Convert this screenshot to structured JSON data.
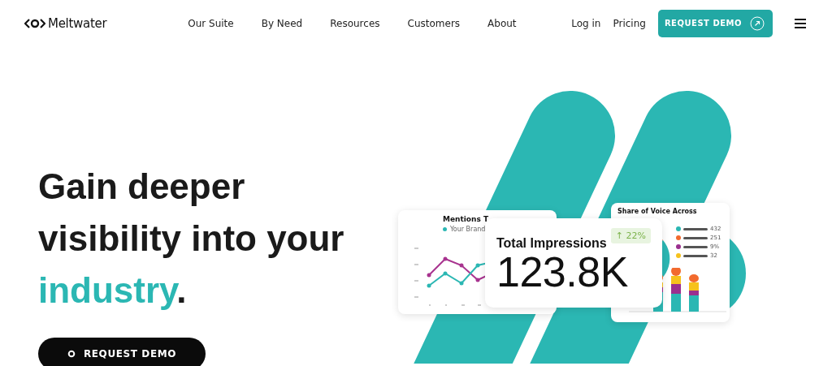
{
  "header": {
    "logo": "Meltwater",
    "nav": [
      "Our Suite",
      "By Need",
      "Resources",
      "Customers",
      "About"
    ],
    "login": "Log in",
    "pricing": "Pricing",
    "cta": "REQUEST DEMO"
  },
  "hero": {
    "headline": [
      [
        {
          "text": "Gain deeper",
          "accent": false
        }
      ],
      [
        {
          "text": "visibility into your",
          "accent": false
        }
      ],
      [
        {
          "text": "industry",
          "accent": true
        },
        {
          "text": ".",
          "accent": false
        }
      ]
    ],
    "cta": "REQUEST DEMO"
  },
  "illustration": {
    "mentions_card": {
      "title": "Mentions T",
      "legend": "Your Brand"
    },
    "impressions_card": {
      "title": "Total Impressions",
      "value": "123.8K",
      "change": "↑ 22%"
    },
    "share_card": {
      "title": "Share of Voice Across",
      "legend": [
        {
          "value": "432",
          "color": "#2bb7b3"
        },
        {
          "value": "251",
          "color": "#f26a2e"
        },
        {
          "value": "9%",
          "color": "#9b2f8e"
        },
        {
          "value": "32",
          "color": "#f6c21c"
        }
      ]
    }
  }
}
